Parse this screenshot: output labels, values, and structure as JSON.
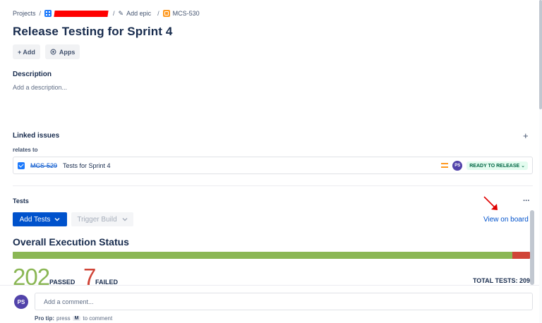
{
  "breadcrumb": {
    "projects": "Projects",
    "separator": "/",
    "add_epic": "Add epic",
    "issue_key": "MCS-530"
  },
  "issue": {
    "title": "Release Testing for Sprint 4"
  },
  "actions": {
    "add": "+ Add",
    "apps": "Apps",
    "apps_icon": "apps-icon"
  },
  "description": {
    "heading": "Description",
    "placeholder": "Add a description..."
  },
  "linked_issues": {
    "heading": "Linked issues",
    "add_symbol": "+",
    "relation": "relates to",
    "items": [
      {
        "key": "MCS-529",
        "summary": "Tests for Sprint 4",
        "priority": "medium",
        "assignee_initials": "PS",
        "status": "READY TO RELEASE",
        "status_color": "#006644"
      }
    ]
  },
  "tests": {
    "heading": "Tests",
    "more_symbol": "···",
    "add_tests_label": "Add Tests",
    "trigger_build_label": "Trigger Build",
    "view_on_board": "View on board",
    "overall_title": "Overall Execution Status",
    "passed_count": "202",
    "passed_label": "PASSED",
    "failed_count": "7",
    "failed_label": "FAILED",
    "total_label": "TOTAL TESTS: 209",
    "pass_fraction": 0.9665,
    "pass_color": "#8bb755",
    "fail_color": "#d04437"
  },
  "comment": {
    "avatar_initials": "PS",
    "placeholder": "Add a comment...",
    "protip_label": "Pro tip:",
    "protip_text_1": "press",
    "protip_key": "M",
    "protip_text_2": "to comment"
  }
}
